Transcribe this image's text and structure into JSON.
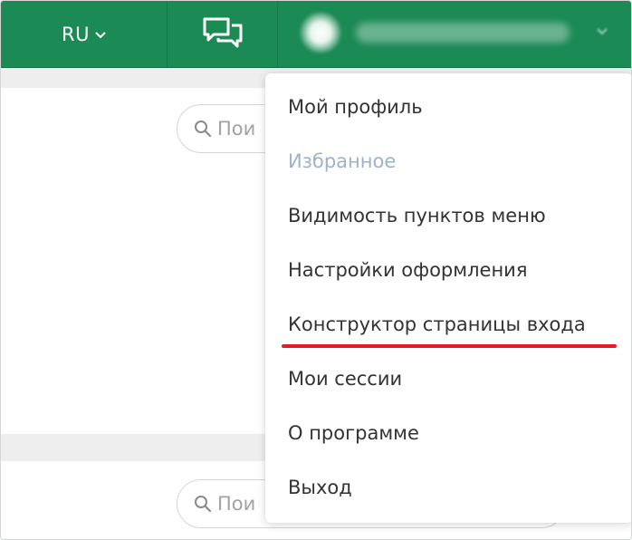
{
  "header": {
    "language": "RU",
    "language_chevron": "chevron-down-icon",
    "chat_icon": "chat-bubbles-icon",
    "avatar_icon": "user-avatar-icon",
    "user_chevron": "chevron-down-icon"
  },
  "page": {
    "search_placeholder": "Пои"
  },
  "menu": {
    "items": [
      {
        "label": "Мой профиль"
      },
      {
        "label": "Избранное"
      },
      {
        "label": "Видимость пунктов меню"
      },
      {
        "label": "Настройки оформления"
      },
      {
        "label": "Конструктор страницы входа"
      },
      {
        "label": "Мои сессии"
      },
      {
        "label": "О программе"
      },
      {
        "label": "Выход"
      }
    ]
  },
  "colors": {
    "topbar": "#1b8a55",
    "menu_text": "#333333",
    "menu_text_muted": "#9fb2c7",
    "highlight_underline": "#e41b23"
  }
}
